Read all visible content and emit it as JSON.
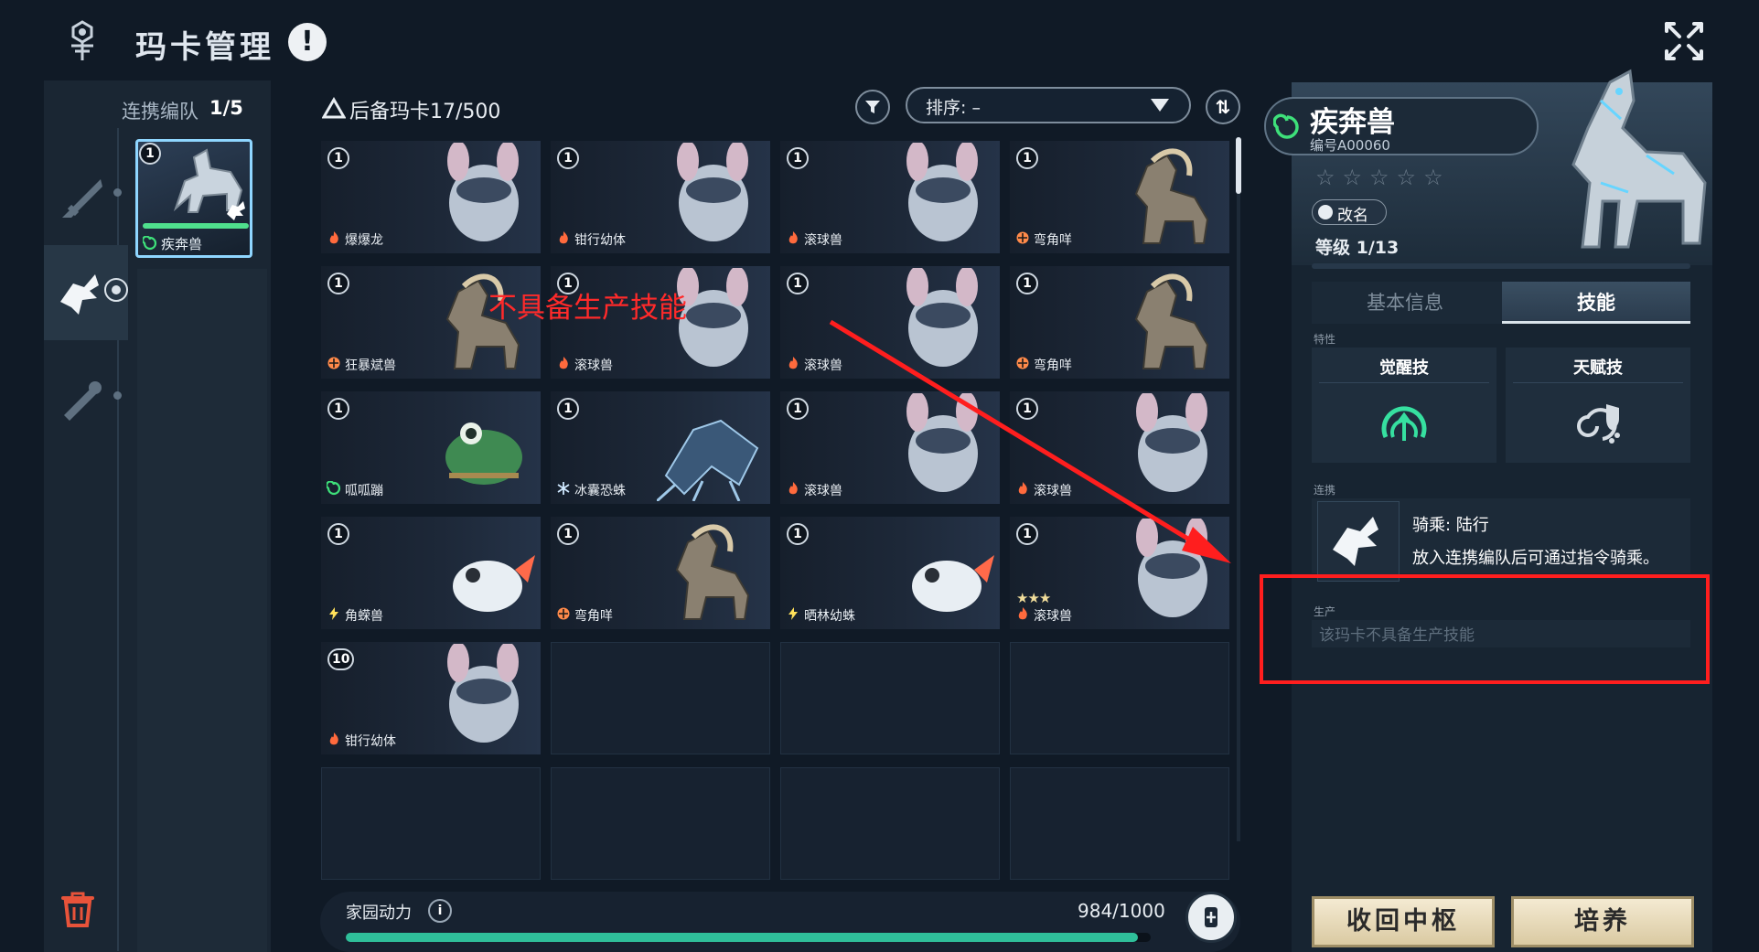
{
  "header": {
    "title": "玛卡管理",
    "info_icon": "!"
  },
  "team": {
    "title": "连携编队",
    "count": "1/5",
    "slot": {
      "level": "1",
      "name": "疾奔兽",
      "element": "wind"
    }
  },
  "grid": {
    "title": "后备玛卡17/500",
    "sort_label": "排序: –",
    "order_icon": "⇅",
    "cards": [
      {
        "level": "1",
        "name": "爆爆龙",
        "element": "fire",
        "stars": ""
      },
      {
        "level": "1",
        "name": "钳行幼体",
        "element": "fire",
        "stars": ""
      },
      {
        "level": "1",
        "name": "滚球兽",
        "element": "fire",
        "stars": ""
      },
      {
        "level": "1",
        "name": "弯角咩",
        "element": "earth",
        "stars": ""
      },
      {
        "level": "1",
        "name": "狂暴斌兽",
        "element": "earth",
        "stars": ""
      },
      {
        "level": "1",
        "name": "滚球兽",
        "element": "fire",
        "stars": ""
      },
      {
        "level": "1",
        "name": "滚球兽",
        "element": "fire",
        "stars": ""
      },
      {
        "level": "1",
        "name": "弯角咩",
        "element": "earth",
        "stars": ""
      },
      {
        "level": "1",
        "name": "呱呱蹦",
        "element": "wind",
        "stars": ""
      },
      {
        "level": "1",
        "name": "冰囊恐蛛",
        "element": "ice",
        "stars": ""
      },
      {
        "level": "1",
        "name": "滚球兽",
        "element": "fire",
        "stars": ""
      },
      {
        "level": "1",
        "name": "滚球兽",
        "element": "fire",
        "stars": ""
      },
      {
        "level": "1",
        "name": "角蝾兽",
        "element": "thunder",
        "stars": ""
      },
      {
        "level": "1",
        "name": "弯角咩",
        "element": "earth",
        "stars": ""
      },
      {
        "level": "1",
        "name": "晒林幼蛛",
        "element": "thunder",
        "stars": ""
      },
      {
        "level": "1",
        "name": "滚球兽",
        "element": "fire",
        "stars": "★★★"
      },
      {
        "level": "10",
        "name": "钳行幼体",
        "element": "fire",
        "stars": ""
      }
    ]
  },
  "energy": {
    "label": "家园动力",
    "value_text": "984/1000",
    "fraction": 0.984
  },
  "detail": {
    "name": "疾奔兽",
    "id": "编号A00060",
    "stars": "☆☆☆☆☆",
    "rename": "改名",
    "level": "等级  1/13",
    "tabs": {
      "basic": "基本信息",
      "skill": "技能"
    },
    "traits_label": "特性",
    "awaken": "觉醒技",
    "talent": "天赋技",
    "link_label": "连携",
    "link_title": "骑乘: 陆行",
    "link_desc": "放入连携编队后可通过指令骑乘。",
    "production_label": "生产",
    "production_text": "该玛卡不具备生产技能",
    "btn_recall": "收回中枢",
    "btn_train": "培养"
  },
  "annotation": {
    "text": "不具备生产技能",
    "color": "#ff2a2a"
  },
  "colors": {
    "fire": "#ff6a3d",
    "earth": "#ff8a4a",
    "wind": "#3ee07a",
    "ice": "#cfe8ff",
    "thunder": "#ffe05a"
  }
}
